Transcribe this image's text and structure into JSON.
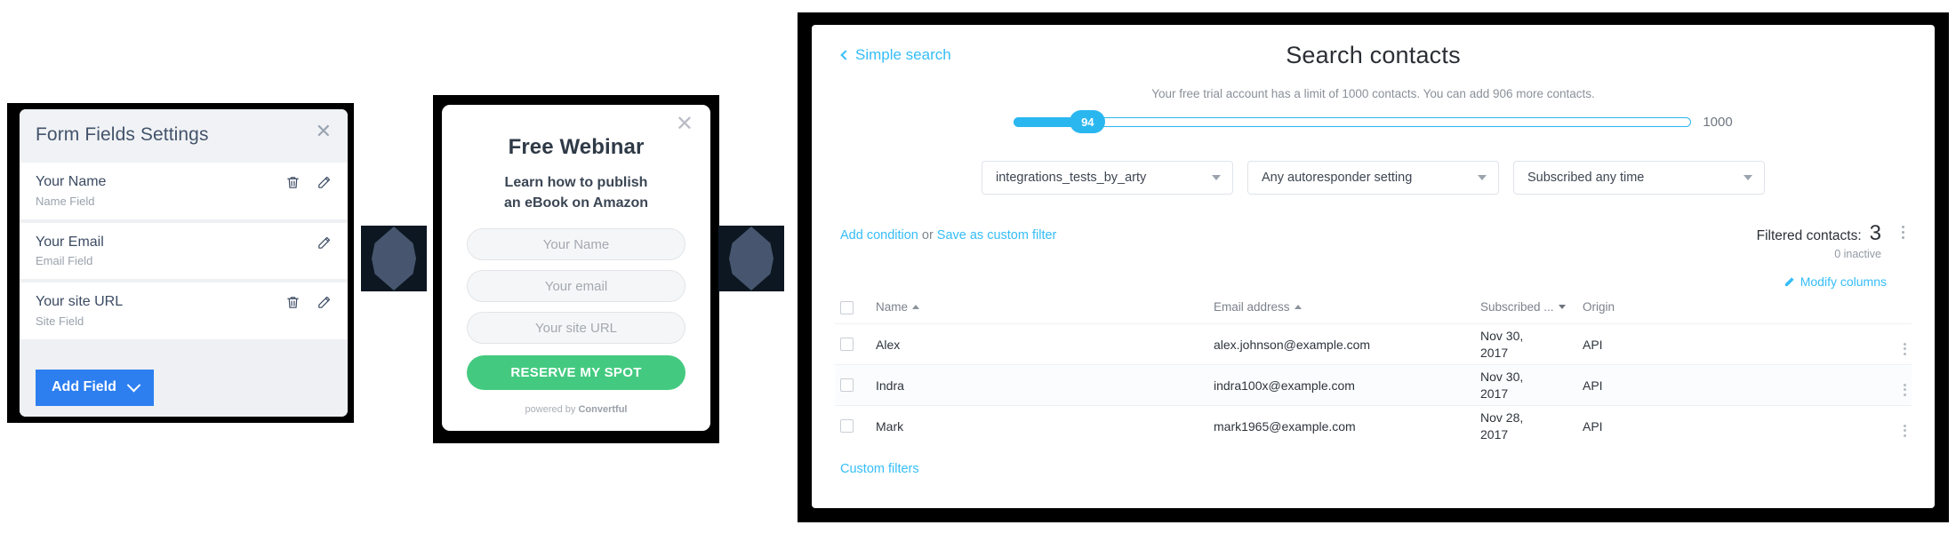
{
  "form_fields_panel": {
    "title": "Form Fields Settings",
    "close_icon": "close-icon",
    "rows": [
      {
        "label": "Your Name",
        "sub": "Name Field",
        "has_delete": true,
        "has_edit": true
      },
      {
        "label": "Your Email",
        "sub": "Email Field",
        "has_delete": false,
        "has_edit": true
      },
      {
        "label": "Your site URL",
        "sub": "Site Field",
        "has_delete": true,
        "has_edit": true
      }
    ],
    "add_field_label": "Add Field",
    "add_field_color": "#2d7ff0"
  },
  "webinar_panel": {
    "close_icon": "close-icon",
    "title": "Free Webinar",
    "subtitle_line1": "Learn how to publish",
    "subtitle_line2": "an eBook on Amazon",
    "inputs": [
      {
        "placeholder": "Your Name"
      },
      {
        "placeholder": "Your email"
      },
      {
        "placeholder": "Your site URL"
      }
    ],
    "cta_label": "RESERVE MY SPOT",
    "cta_color": "#43ca80",
    "powered_prefix": "powered by ",
    "powered_brand": "Convertful"
  },
  "connectors": [
    {
      "shape": "diamond",
      "bg": "#0c1722",
      "fill": "#47566e"
    },
    {
      "shape": "diamond",
      "bg": "#0c1722",
      "fill": "#47566e"
    }
  ],
  "contacts_panel": {
    "back_link": "Simple search",
    "title": "Search contacts",
    "trial_notice": "Your free trial account has a limit of 1000 contacts. You can add 906 more contacts.",
    "slider": {
      "value": "94",
      "max_label": "1000",
      "accent": "#2ab7f0"
    },
    "filters": [
      {
        "value": "integrations_tests_by_arty"
      },
      {
        "value": "Any autoresponder setting"
      },
      {
        "value": "Subscribed any time"
      }
    ],
    "add_condition": "Add condition",
    "or_text": "or",
    "save_as_custom_filter": "Save as custom filter",
    "filtered_label": "Filtered contacts:",
    "filtered_count": "3",
    "inactive_text": "0 inactive",
    "modify_columns": "Modify columns",
    "link_color": "#35bdf8",
    "table": {
      "columns": [
        "Name",
        "Email address",
        "Subscribed ...",
        "Origin"
      ],
      "rows": [
        {
          "name": "Alex",
          "email": "alex.johnson@example.com",
          "date_line1": "Nov 30,",
          "date_line2": "2017",
          "origin": "API"
        },
        {
          "name": "Indra",
          "email": "indra100x@example.com",
          "date_line1": "Nov 30,",
          "date_line2": "2017",
          "origin": "API"
        },
        {
          "name": "Mark",
          "email": "mark1965@example.com",
          "date_line1": "Nov 28,",
          "date_line2": "2017",
          "origin": "API"
        }
      ]
    },
    "custom_filters": "Custom filters"
  }
}
